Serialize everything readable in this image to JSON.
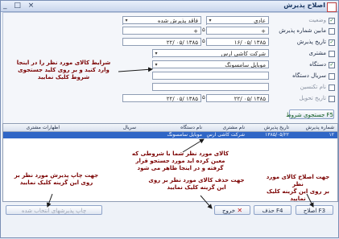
{
  "window": {
    "title": "اصلاح پذیرش",
    "buttons": "_ □ ×"
  },
  "form": {
    "rows": [
      {
        "label": "وضعیت",
        "checked": true,
        "dim": true
      },
      {
        "label": "مابین شماره پذیرش",
        "checked": false,
        "dim": false
      },
      {
        "label": "تاریخ پذیرش",
        "checked": true,
        "dim": false
      },
      {
        "label": "مشتری",
        "checked": false,
        "dim": false
      },
      {
        "label": "دستگاه",
        "checked": true,
        "dim": false
      },
      {
        "label": "سریال دستگاه",
        "checked": false,
        "dim": false
      },
      {
        "label": "نام تکنسین",
        "checked": false,
        "dim": true
      },
      {
        "label": "تاریخ تحویل",
        "checked": false,
        "dim": true
      }
    ],
    "status_value": "عادی",
    "status_value2": "فاقد پذیرش شده",
    "date_from": "۱۳۸۵ /۰۵ /۱۶",
    "date_to": "۱۳۸۵ /۰۵ /۲۲",
    "customer_value": "شرکت کاشی ارس",
    "device_value": "موبایل سامسونگ",
    "delivery_from": "۱۳۸۵ /۰۵ /۲۲",
    "delivery_to": "۱۳۸۵ /۰۵ /۲۲",
    "tilde": "تا",
    "search_button": "F5 جستجوی شروط"
  },
  "annotations": {
    "criteria": "شرایط کالای مورد نظر را در اینجا\nوارد کنید و بر روی کلید جستجوی\nشروط کلیک نمایید",
    "results": "کالای مورد نظر شما با شروطی که\nمعین کرده اید مورد جستجو قرار\nگرفته و در اینجا ظاهر می شود",
    "print": "جهت چاپ پذیرش مورد نظر بر\nروی این گزینه کلیک نمایید",
    "delete": "جهت حذف کالای مورد نظر بر روی\nاین گزینه کلیک نمایید",
    "edit": "جهت اصلاح کالای مورد نظر\nبر روی این گزینه کلیک نمایید"
  },
  "grid": {
    "columns": [
      "شماره پذیرش",
      "تاریخ پذیرش",
      "نام مشتری",
      "نام دستگاه",
      "سریال",
      "اظهارات مشتری"
    ],
    "rows": [
      [
        "۱۲",
        "۱۳۸۵/۰۵/۲۲",
        "شرکت کاشی ارس",
        "موبایل سامسونگ",
        "",
        ""
      ]
    ]
  },
  "toolbar": {
    "edit": "F3 اصلاح",
    "delete": "F4 حذف",
    "exit": "خروج",
    "print": "چاپ پذیرشهای انتخاب شده"
  }
}
